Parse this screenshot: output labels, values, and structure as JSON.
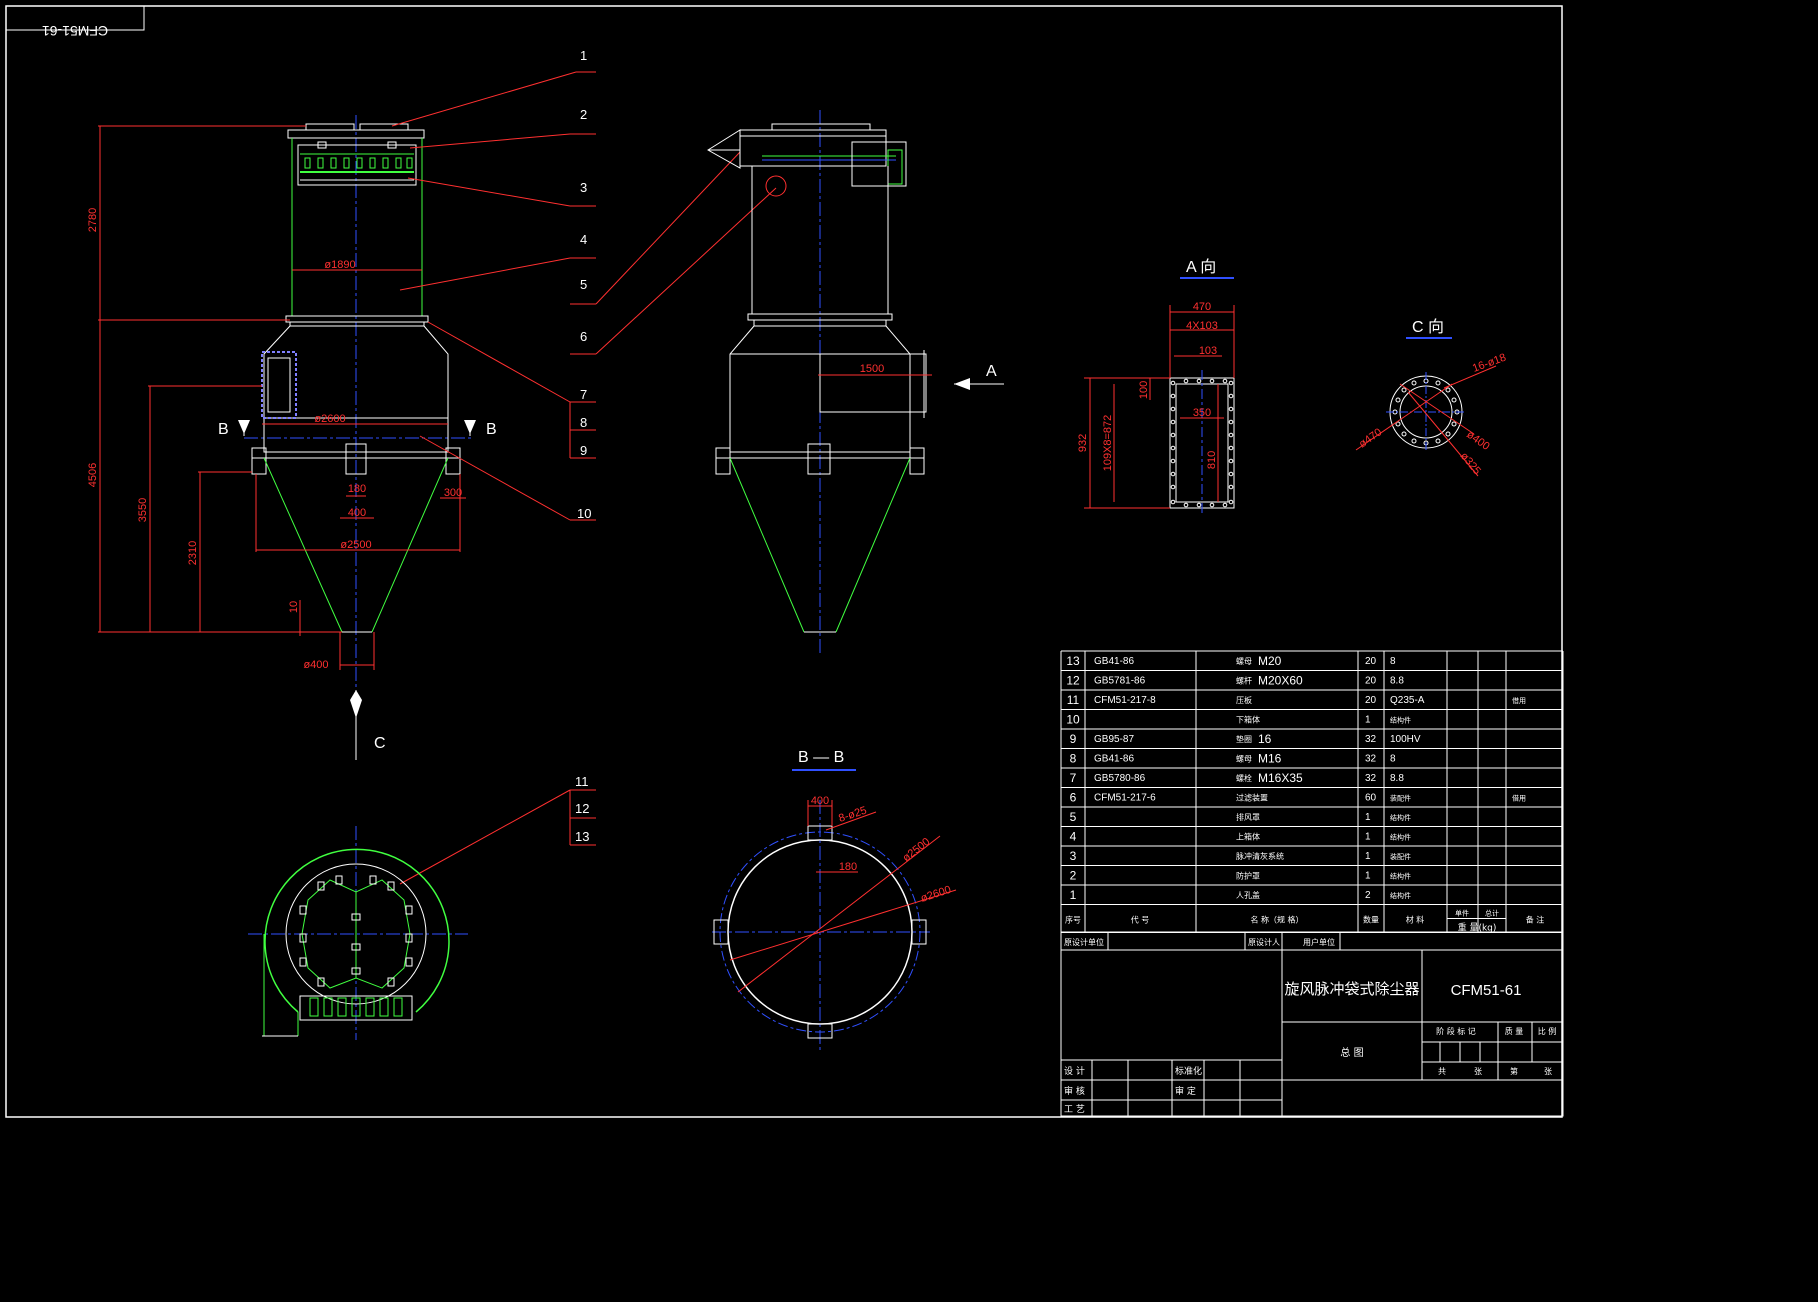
{
  "drawing_number_mirrored": "CFM51-61",
  "balloons": [
    "1",
    "2",
    "3",
    "4",
    "5",
    "6",
    "7",
    "8",
    "9",
    "10",
    "11",
    "12",
    "13"
  ],
  "section_marks": {
    "a": "A",
    "b": "B",
    "c": "C"
  },
  "view_titles": {
    "a_view": "A 向",
    "c_view": "C 向",
    "bb_section": "B — B"
  },
  "dimensions": {
    "h_2780": "2780",
    "h_4506": "4506",
    "h_3550": "3550",
    "h_2310": "2310",
    "h_10": "10",
    "d_1890": "ø1890",
    "d_2600_top": "ø2600",
    "d_2500": "ø2500",
    "d_400_outlet": "ø400",
    "w_180": "180",
    "w_400": "400",
    "w_300": "300",
    "inlet_1500": "1500",
    "a_470": "470",
    "a_4x103": "4X103",
    "a_103": "103",
    "a_932": "932",
    "a_109x8": "109X8=872",
    "a_350": "350",
    "a_810": "810",
    "a_100": "100",
    "c_16": "16-ø18",
    "c_470": "ø470",
    "c_400": "ø400",
    "c_325": "ø325",
    "bb_400": "400",
    "bb_8": "8-ø25",
    "bb_180": "180",
    "bb_2500": "ø2500",
    "bb_2600": "ø2600"
  },
  "bom": {
    "rows": [
      {
        "no": "13",
        "code": "GB41-86",
        "name": "螺母 M20",
        "qty": "20",
        "material": "8",
        "note": ""
      },
      {
        "no": "12",
        "code": "GB5781-86",
        "name": "螺杆 M20X60",
        "qty": "20",
        "material": "8.8",
        "note": ""
      },
      {
        "no": "11",
        "code": "CFM51-217-8",
        "name": "压板",
        "qty": "20",
        "material": "Q235-A",
        "note": "借用"
      },
      {
        "no": "10",
        "code": "",
        "name": "下箱体",
        "qty": "1",
        "material": "结构件",
        "note": ""
      },
      {
        "no": "9",
        "code": "GB95-87",
        "name": "垫圈 16",
        "qty": "32",
        "material": "100HV",
        "note": ""
      },
      {
        "no": "8",
        "code": "GB41-86",
        "name": "螺母 M16",
        "qty": "32",
        "material": "8",
        "note": ""
      },
      {
        "no": "7",
        "code": "GB5780-86",
        "name": "螺栓 M16X35",
        "qty": "32",
        "material": "8.8",
        "note": ""
      },
      {
        "no": "6",
        "code": "CFM51-217-6",
        "name": "过滤装置",
        "qty": "60",
        "material": "装配件",
        "note": "借用"
      },
      {
        "no": "5",
        "code": "",
        "name": "排风罩",
        "qty": "1",
        "material": "结构件",
        "note": ""
      },
      {
        "no": "4",
        "code": "",
        "name": "上箱体",
        "qty": "1",
        "material": "结构件",
        "note": ""
      },
      {
        "no": "3",
        "code": "",
        "name": "脉冲清灰系统",
        "qty": "1",
        "material": "装配件",
        "note": ""
      },
      {
        "no": "2",
        "code": "",
        "name": "防护罩",
        "qty": "1",
        "material": "结构件",
        "note": ""
      },
      {
        "no": "1",
        "code": "",
        "name": "人孔盖",
        "qty": "2",
        "material": "结构件",
        "note": ""
      }
    ],
    "header": {
      "no": "序号",
      "code": "代 号",
      "name": "名 称（规 格）",
      "qty": "数量",
      "material": "材 料",
      "unit": "单件",
      "total": "总计",
      "weight": "重 量(kg)",
      "note": "备 注"
    }
  },
  "title_block": {
    "orig_design_unit": "原设计单位",
    "orig_designer": "原设计人",
    "user_unit": "用户单位",
    "product_name": "旋风脉冲袋式除尘器",
    "drawing_no": "CFM51-61",
    "drawing_title": "总 图",
    "stage_mark": "阶 段 标 记",
    "weight": "质 量",
    "scale": "比 例",
    "total_sheets": "共",
    "sheet": "张",
    "sheet_no": "第",
    "sheet_no_unit": "张",
    "design": "设 计",
    "standardize": "标准化",
    "review": "审 核",
    "approve": "审 定",
    "process": "工 艺"
  }
}
